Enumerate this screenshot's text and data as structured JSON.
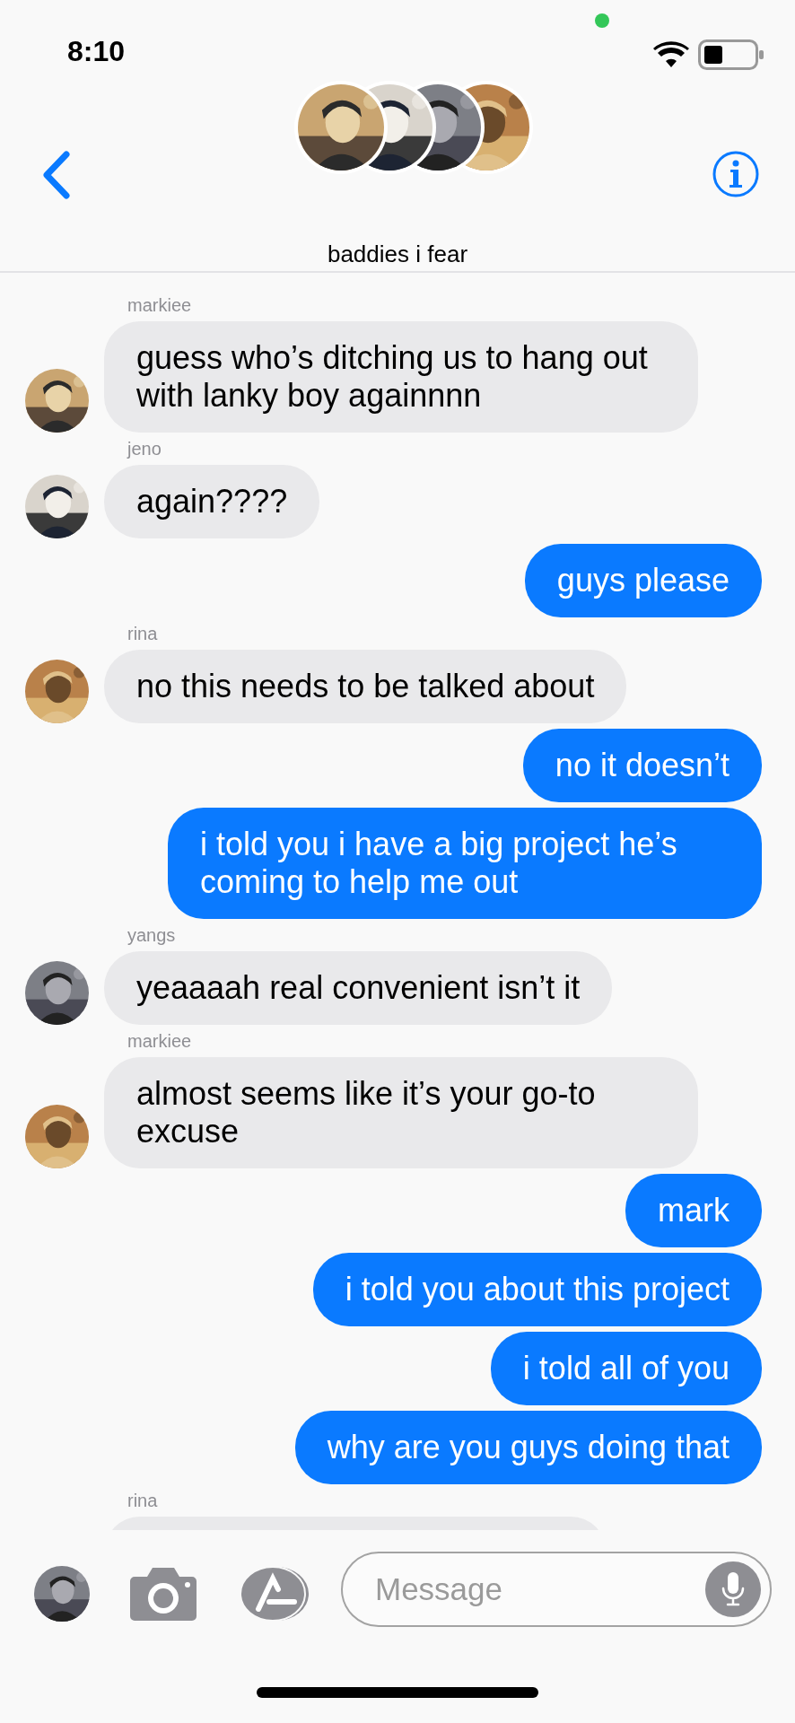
{
  "status_bar": {
    "time": "8:10"
  },
  "header": {
    "title": "baddies i fear"
  },
  "messages": [
    {
      "kind": "received",
      "sender": "markiee",
      "text": "guess who’s ditching us to hang out with lanky boy againnnn"
    },
    {
      "kind": "received",
      "sender": "jeno",
      "text": "again????"
    },
    {
      "kind": "sent",
      "text": "guys please"
    },
    {
      "kind": "received",
      "sender": "rina",
      "text": "no this needs to be talked about"
    },
    {
      "kind": "sent",
      "text": "no it doesn’t"
    },
    {
      "kind": "sent",
      "text": "i told you i have a big project he’s coming to help me out"
    },
    {
      "kind": "received",
      "sender": "yangs",
      "text": "yeaaaah real convenient isn’t it"
    },
    {
      "kind": "received",
      "sender": "markiee",
      "text": "almost seems like it’s your go-to excuse"
    },
    {
      "kind": "sent",
      "text": "mark"
    },
    {
      "kind": "sent",
      "text": "i told you about this project"
    },
    {
      "kind": "sent",
      "text": "i told all of you"
    },
    {
      "kind": "sent",
      "text": "why are you guys doing that"
    },
    {
      "kind": "received",
      "sender": "rina"
    }
  ],
  "composer": {
    "placeholder": "Message"
  }
}
